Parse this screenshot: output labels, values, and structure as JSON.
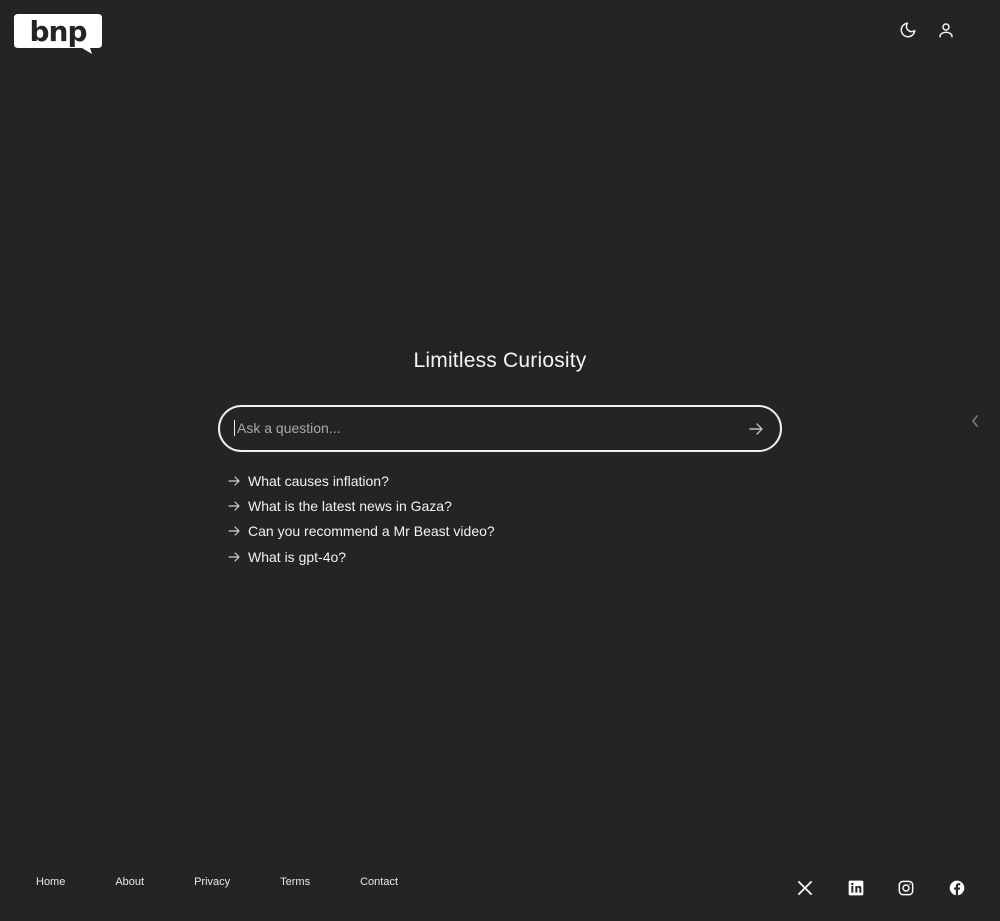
{
  "brand": {
    "logo_text": "bnp"
  },
  "header": {
    "icons": [
      "moon-icon",
      "user-icon"
    ]
  },
  "hero": {
    "title": "Limitless Curiosity"
  },
  "search": {
    "placeholder": "Ask a question...",
    "value": "",
    "submit_icon": "arrow-right-icon"
  },
  "suggestions": [
    {
      "label": "What causes inflation?"
    },
    {
      "label": "What is the latest news in Gaza?"
    },
    {
      "label": "Can you recommend a Mr Beast video?"
    },
    {
      "label": "What is gpt-4o?"
    }
  ],
  "side_panel": {
    "icon": "chevron-left-icon"
  },
  "footer": {
    "links": [
      {
        "label": "Home"
      },
      {
        "label": "About"
      },
      {
        "label": "Privacy"
      },
      {
        "label": "Terms"
      },
      {
        "label": "Contact"
      }
    ],
    "social_icons": [
      "x-icon",
      "linkedin-icon",
      "instagram-icon",
      "facebook-icon"
    ]
  },
  "colors": {
    "background": "#242424",
    "text": "#f2f2f2",
    "placeholder": "#a9a9a9",
    "border": "#f0f0f0"
  }
}
